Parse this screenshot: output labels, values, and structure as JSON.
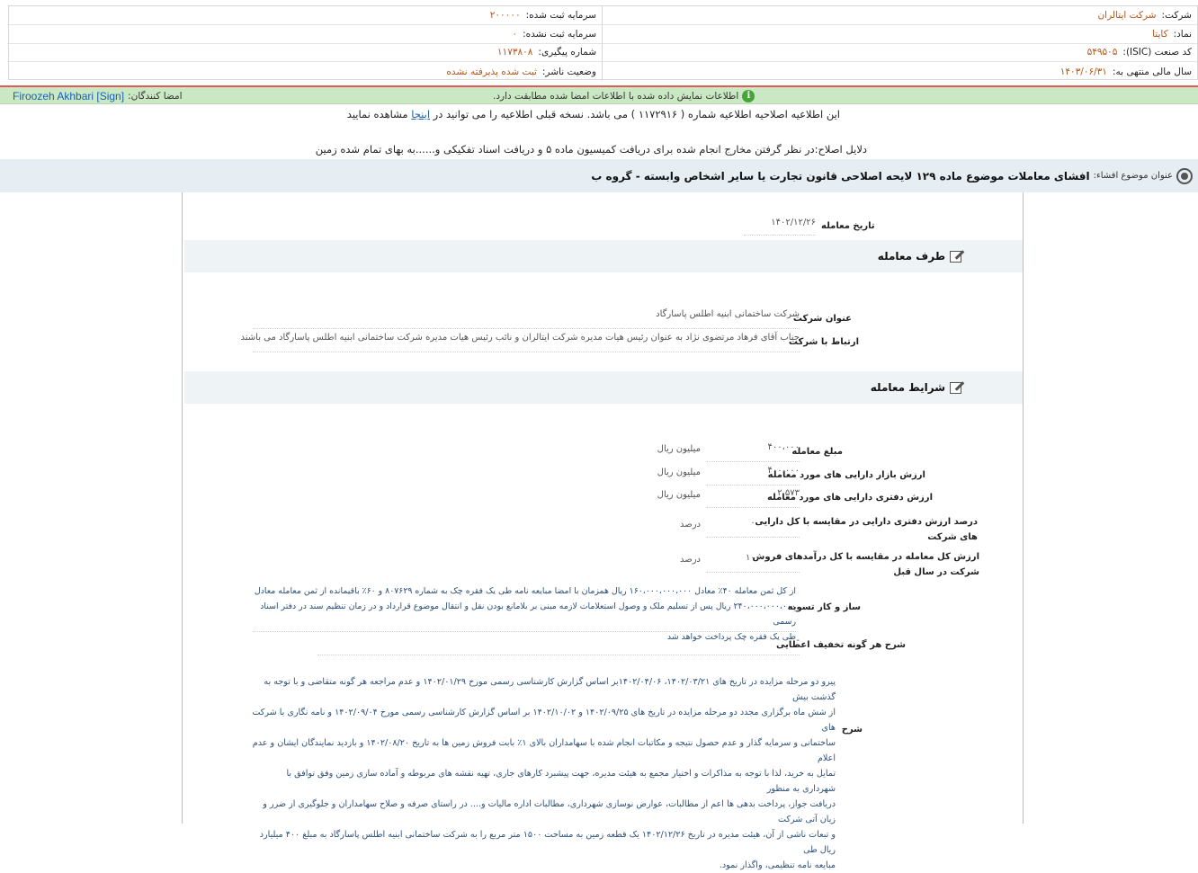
{
  "header": {
    "company_label": "شرکت:",
    "company_value": "شرکت ایتالران",
    "symbol_label": "نماد:",
    "symbol_value": "کایتا",
    "isic_label": "کد صنعت (ISIC):",
    "isic_value": "۵۴۹۵۰۵",
    "fiscal_label": "سال مالی منتهی به:",
    "fiscal_value": "۱۴۰۳/۰۶/۳۱",
    "reg_capital_label": "سرمایه ثبت شده:",
    "reg_capital_value": "۲۰۰۰۰۰",
    "unreg_capital_label": "سرمایه ثبت نشده:",
    "unreg_capital_value": "۰",
    "tracking_label": "شماره پیگیری:",
    "tracking_value": "۱۱۷۳۸۰۸",
    "publisher_status_label": "وضعیت ناشر:",
    "publisher_status_value": "ثبت شده پذیرفته نشده"
  },
  "signature": {
    "message": "اطلاعات نمایش داده شده با اطلاعات امضا شده مطابقت دارد.",
    "signers_label": "امضا کنندگان:",
    "signer": "Firoozeh Akhbari [Sign]"
  },
  "notice": {
    "text_before": "این اطلاعیه اصلاحیه اطلاعیه شماره ( ۱۱۷۲۹۱۶ ) می باشد. نسخه قبلی اطلاعیه را می توانید در",
    "link": "اینجا",
    "text_after": "مشاهده نمایید",
    "reason": "دلایل اصلاح:در نظر گرفتن مخارج انجام شده برای دریافت کمیسیون ماده ۵ و دریافت اسناد تفکیکی و......به بهای تمام شده زمین"
  },
  "topic": {
    "label": "عنوان موضوع افشاء:",
    "value": "افشای معاملات موضوع ماده ۱۲۹ لایحه اصلاحی قانون تجارت یا سایر اشخاص وابسته - گروه ب"
  },
  "transaction_date": {
    "label": "تاریخ معامله",
    "value": "۱۴۰۲/۱۲/۲۶"
  },
  "party": {
    "section_title": "طرف معامله",
    "company_title_label": "عنوان شرکت",
    "company_title_value": "شرکت ساختمانی ابنیه اطلس پاسارگاد",
    "relation_label": "ارتباط با شرکت",
    "relation_value": "جناب آقای فرهاد مرتضوی نژاد به عنوان رئیس هیات مدیره شرکت ایتالران و نائب رئیس هیات مدیره شرکت ساختمانی ابنیه اطلس پاسارگاد می باشند"
  },
  "terms": {
    "section_title": "شرایط معامله",
    "rows": [
      {
        "label": "مبلغ معامله",
        "value": "۴۰۰،۰۰۰",
        "unit": "میلیون ریال"
      },
      {
        "label": "ارزش بازار دارایی های مورد معامله",
        "value": "۴۰۰،۰۰۰",
        "unit": "میلیون ریال"
      },
      {
        "label": "ارزش دفتری دارایی های مورد معامله",
        "value": "۲،۵۷۳",
        "unit": "میلیون ریال"
      },
      {
        "label": "درصد ارزش دفتری دارایی در مقایسه با کل دارایی های شرکت",
        "label_1": "درصد ارزش دفتری دارایی در مقایسه با کل دارایی",
        "label_2": "های شرکت",
        "value": "۰",
        "unit": "درصد"
      },
      {
        "label": "ارزش کل معامله در مقایسه با کل درآمدهای فروش شرکت در سال قبل",
        "label_1": "ارزش کل معامله در مقایسه با کل درآمدهای فروش",
        "label_2": "شرکت در سال قبل",
        "value": "۱۰۰",
        "unit": "درصد"
      }
    ],
    "settlement_label": "ساز و کار تسویه",
    "settlement_lines": [
      "از کل ثمن معامله ۴۰٪ معادل ۱۶۰،۰۰۰،۰۰۰،۰۰۰ ریال همزمان با امضا مبایعه نامه طی یک فقره چک به شماره ۸۰۷۶۲۹ و ۶۰٪ باقیمانده از ثمن معامله معادل",
      "۲۴۰،۰۰۰،۰۰۰،۰۰۰ ریال پس از تسلیم ملک و وصول استعلامات لازمه مبنی بر بلامانع بودن نقل و انتقال موضوع قرارداد و در زمان تنظیم سند در دفتر اسناد رسمی",
      "طی یک فقره چک پرداخت خواهد شد"
    ],
    "discount_label": "شرح هر گونه تخفیف اعطایی",
    "discount_value": "-"
  },
  "description": {
    "label": "شرح",
    "lines": [
      "پیرو دو مرحله مزایده در تاریخ های ۱۴۰۲/۰۳/۲۱، ۱۴۰۲/۰۴/۰۶بر اساس گزارش کارشناسی رسمی مورخ ۱۴۰۲/۰۱/۲۹ و عدم مراجعه هر گونه متقاضی و با توجه به گذشت بیش",
      "از شش ماه برگزاری مجدد دو مرحله مزایده در تاریخ های ۱۴۰۲/۰۹/۲۵ و ۱۴۰۲/۱۰/۰۲ بر اساس گزارش کارشناسی رسمی مورخ ۱۴۰۲/۰۹/۰۴ و نامه نگاری با شرکت های",
      "ساختمانی و سرمایه گذار و عدم حصول نتیجه و مکاتبات انجام شده با سهامداران بالای ۱٪ بابت فروش زمین ها به تاریخ ۱۴۰۲/۰۸/۲۰ و بازدید نمایندگان ایشان و عدم اعلام",
      "تمایل به خرید، لذا با توجه به مذاکرات و اختیار مجمع به هیئت مدیره، جهت پیشبرد کارهای جاری، تهیه نقشه های مربوطه و آماده سازی زمین وفق توافق با شهرداری به منظور",
      "دریافت جواز، پرداخت بدهی ها اعم از مطالبات، عوارض نوسازی شهرداری، مطالبات اداره مالیات و.... در راستای صرفه و صلاح سهامداران و جلوگیری از ضرر و زیان آتی شرکت",
      "و تبعات ناشی از آن، هیئت مدیره در تاریخ ۱۴۰۲/۱۲/۲۶ یک قطعه زمین به مساحت ۱۵۰۰ متر مربع را به شرکت ساختمانی ابنیه اطلس پاسارگاد به مبلغ ۴۰۰ میلیارد ریال طی",
      "مبایعه نامه تنظیمی، واگذار نمود."
    ]
  }
}
